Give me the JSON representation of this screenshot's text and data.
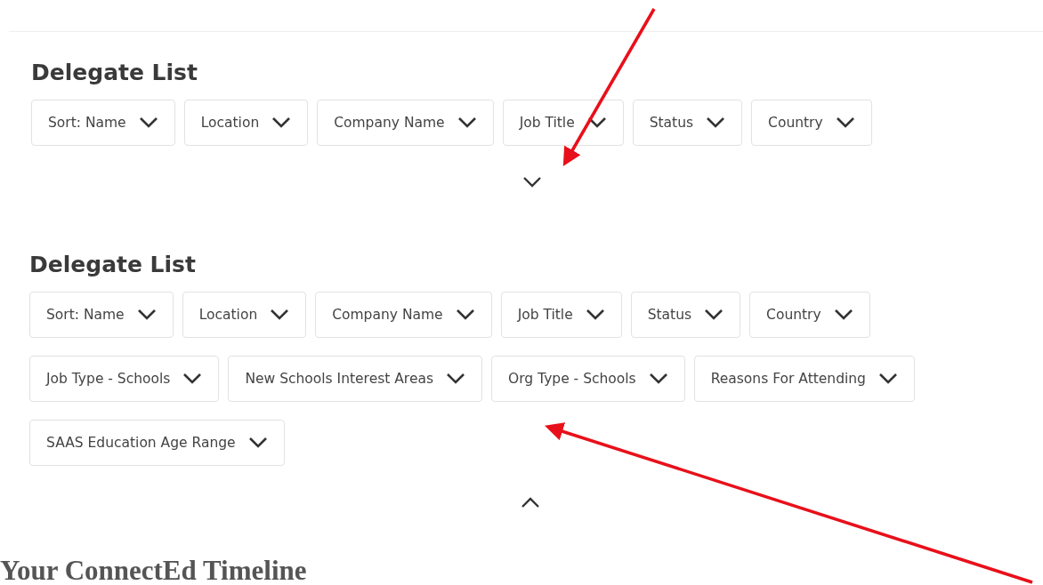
{
  "panels": [
    {
      "title": "Delegate List",
      "expanded": false,
      "filters": [
        "Sort: Name",
        "Location",
        "Company Name",
        "Job Title",
        "Status",
        "Country"
      ]
    },
    {
      "title": "Delegate List",
      "expanded": true,
      "filters": [
        "Sort: Name",
        "Location",
        "Company Name",
        "Job Title",
        "Status",
        "Country",
        "Job Type - Schools",
        "New Schools Interest Areas",
        "Org Type - Schools",
        "Reasons For Attending",
        "SAAS Education Age Range"
      ]
    }
  ],
  "timeline_heading": "Your ConnectEd Timeline"
}
